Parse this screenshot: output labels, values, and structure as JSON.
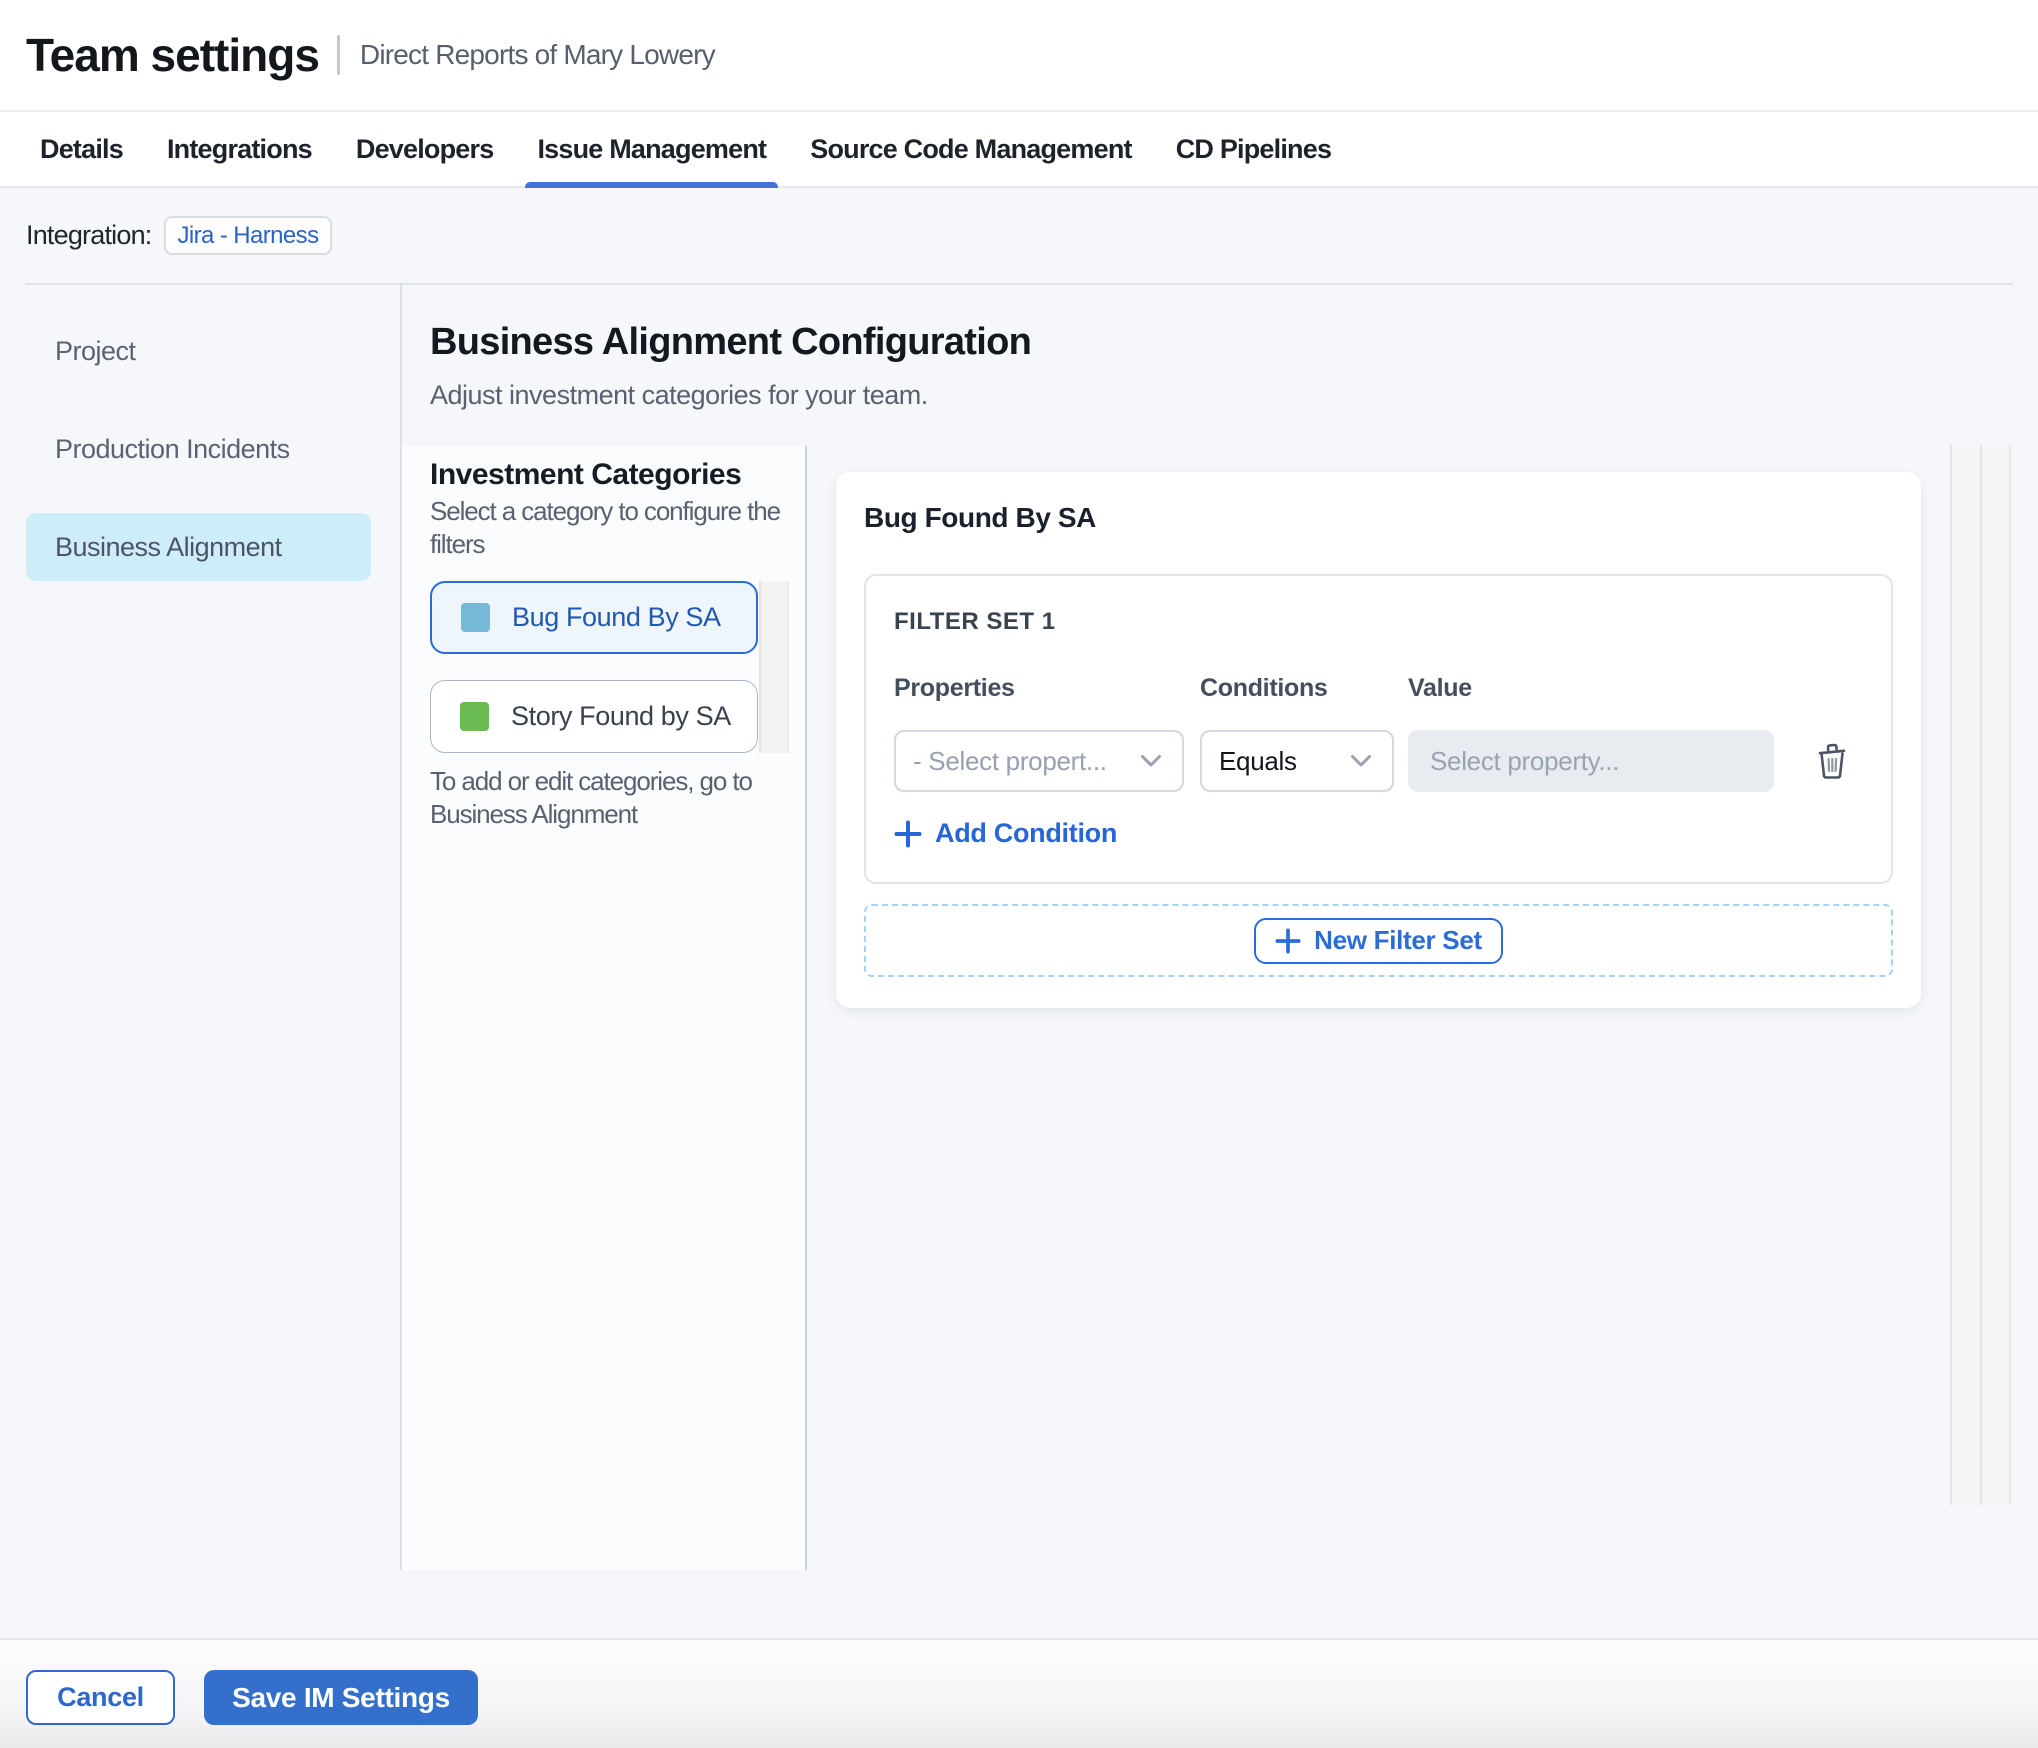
{
  "header": {
    "title": "Team settings",
    "subtitle": "Direct Reports of Mary Lowery"
  },
  "tabs": [
    {
      "label": "Details",
      "active": false
    },
    {
      "label": "Integrations",
      "active": false
    },
    {
      "label": "Developers",
      "active": false
    },
    {
      "label": "Issue Management",
      "active": true
    },
    {
      "label": "Source Code Management",
      "active": false
    },
    {
      "label": "CD Pipelines",
      "active": false
    }
  ],
  "integration": {
    "label": "Integration:",
    "chip": "Jira - Harness"
  },
  "sidebar": {
    "items": [
      {
        "label": "Project",
        "active": false
      },
      {
        "label": "Production Incidents",
        "active": false
      },
      {
        "label": "Business Alignment",
        "active": true
      }
    ]
  },
  "main": {
    "title": "Business Alignment Configuration",
    "subtitle": "Adjust investment categories for your team.",
    "categories": {
      "heading": "Investment Categories",
      "hint": "Select a category to configure the\nfilters",
      "items": [
        {
          "label": "Bug Found By SA",
          "color": "#76b9d7",
          "active": true
        },
        {
          "label": "Story Found by SA",
          "color": "#6abc52",
          "active": false
        }
      ],
      "footnote": "To add or edit categories, go to\nBusiness Alignment"
    },
    "panel": {
      "title": "Bug Found By SA",
      "filter_set": {
        "heading": "FILTER SET 1",
        "properties_label": "Properties",
        "conditions_label": "Conditions",
        "value_label": "Value",
        "property_placeholder": "- Select propert...",
        "condition_value": "Equals",
        "value_placeholder": "Select property...",
        "add_condition_label": "Add Condition"
      },
      "new_filter_set_label": "New Filter Set"
    }
  },
  "footer": {
    "cancel_label": "Cancel",
    "save_label": "Save IM Settings"
  },
  "colors": {
    "accent_blue": "#2b6cd9",
    "save_button": "#3470cb",
    "active_tab_underline": "#4273d3",
    "selected_nav_bg": "#cdeef9",
    "bug_swatch": "#76b9d7",
    "story_swatch": "#6abc52"
  }
}
